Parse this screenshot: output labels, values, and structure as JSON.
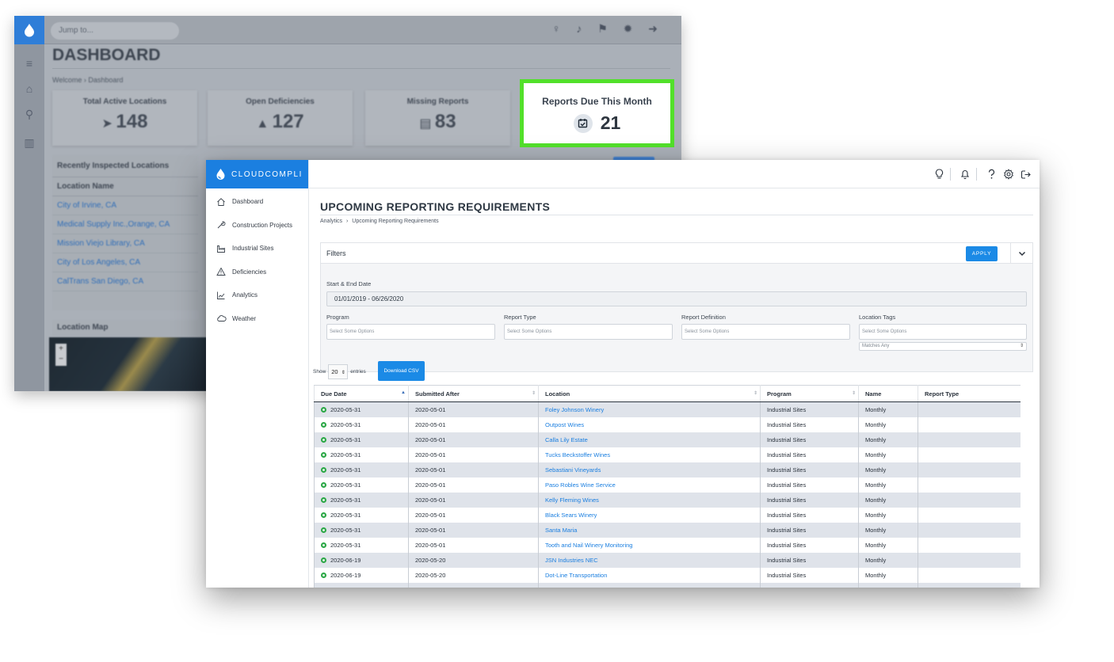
{
  "background": {
    "search_placeholder": "Jump to...",
    "title": "DASHBOARD",
    "breadcrumb": "Welcome › Dashboard",
    "cards": [
      {
        "label": "Total Active Locations",
        "value": "148",
        "icon": "send-icon"
      },
      {
        "label": "Open Deficiencies",
        "value": "127",
        "icon": "warning-icon"
      },
      {
        "label": "Missing Reports",
        "value": "83",
        "icon": "document-icon"
      }
    ],
    "recent_panel": {
      "title": "Recently Inspected Locations",
      "column": "Location Name",
      "rows": [
        "City of Irvine, CA",
        "Medical Supply Inc.,Orange, CA",
        "Mission Viejo Library, CA",
        "City of Los Angeles, CA",
        "CalTrans San Diego, CA"
      ]
    },
    "map_title": "Location Map",
    "highlight_card": {
      "label": "Reports Due This Month",
      "value": "21",
      "icon": "calendar-check-icon"
    },
    "highlight_color": "#52e02a"
  },
  "app": {
    "brand": "CLOUDCOMPLI",
    "brand_color": "#1b7fe0",
    "nav": [
      {
        "label": "Dashboard",
        "icon": "home-icon"
      },
      {
        "label": "Construction Projects",
        "icon": "wrench-icon"
      },
      {
        "label": "Industrial Sites",
        "icon": "factory-icon"
      },
      {
        "label": "Deficiencies",
        "icon": "warning-icon"
      },
      {
        "label": "Analytics",
        "icon": "chart-icon"
      },
      {
        "label": "Weather",
        "icon": "cloud-icon"
      }
    ],
    "top_icons": [
      "lightbulb-icon",
      "bell-icon",
      "help-icon",
      "gear-icon",
      "logout-icon"
    ],
    "page_title": "UPCOMING REPORTING REQUIREMENTS",
    "breadcrumb": {
      "parent": "Analytics",
      "separator": "›",
      "current": "Upcoming Reporting Requirements"
    },
    "filters": {
      "title": "Filters",
      "apply_label": "APPLY",
      "date_label": "Start & End Date",
      "date_value": "01/01/2019 - 06/26/2020",
      "program_label": "Program",
      "program_placeholder": "Select Some Options",
      "report_type_label": "Report Type",
      "report_type_placeholder": "Select Some Options",
      "report_def_label": "Report Definition",
      "report_def_placeholder": "Select Some Options",
      "tags_label": "Location Tags",
      "tags_placeholder": "Select Some Options",
      "tags_match": "Matches Any"
    },
    "table_controls": {
      "show": "Show",
      "entries_value": "20",
      "entries": "entries",
      "csv_label": "Download CSV"
    },
    "table": {
      "columns": [
        "Due Date",
        "Submitted After",
        "Location",
        "Program",
        "Name",
        "Report Type"
      ],
      "rows": [
        {
          "due": "2020-05-31",
          "after": "2020-05-01",
          "location": "Foley Johnson Winery",
          "program": "Industrial Sites",
          "name": "Monthly",
          "type": ""
        },
        {
          "due": "2020-05-31",
          "after": "2020-05-01",
          "location": "Outpost Wines",
          "program": "Industrial Sites",
          "name": "Monthly",
          "type": ""
        },
        {
          "due": "2020-05-31",
          "after": "2020-05-01",
          "location": "Calla Lily Estate",
          "program": "Industrial Sites",
          "name": "Monthly",
          "type": ""
        },
        {
          "due": "2020-05-31",
          "after": "2020-05-01",
          "location": "Tucks Beckstoffer Wines",
          "program": "Industrial Sites",
          "name": "Monthly",
          "type": ""
        },
        {
          "due": "2020-05-31",
          "after": "2020-05-01",
          "location": "Sebastiani Vineyards",
          "program": "Industrial Sites",
          "name": "Monthly",
          "type": ""
        },
        {
          "due": "2020-05-31",
          "after": "2020-05-01",
          "location": "Paso Robles Wine Service",
          "program": "Industrial Sites",
          "name": "Monthly",
          "type": ""
        },
        {
          "due": "2020-05-31",
          "after": "2020-05-01",
          "location": "Kelly Fleming Wines",
          "program": "Industrial Sites",
          "name": "Monthly",
          "type": ""
        },
        {
          "due": "2020-05-31",
          "after": "2020-05-01",
          "location": "Black Sears Winery",
          "program": "Industrial Sites",
          "name": "Monthly",
          "type": ""
        },
        {
          "due": "2020-05-31",
          "after": "2020-05-01",
          "location": "Santa Maria",
          "program": "Industrial Sites",
          "name": "Monthly",
          "type": ""
        },
        {
          "due": "2020-05-31",
          "after": "2020-05-01",
          "location": "Tooth and Nail Winery Monitoring",
          "program": "Industrial Sites",
          "name": "Monthly",
          "type": ""
        },
        {
          "due": "2020-06-19",
          "after": "2020-05-20",
          "location": "JSN Industries NEC",
          "program": "Industrial Sites",
          "name": "Monthly",
          "type": ""
        },
        {
          "due": "2020-06-19",
          "after": "2020-05-20",
          "location": "Dot-Line Transportation",
          "program": "Industrial Sites",
          "name": "Monthly",
          "type": ""
        }
      ]
    },
    "accent_color": "#1b8ae6",
    "status_color": "#2aa745"
  }
}
